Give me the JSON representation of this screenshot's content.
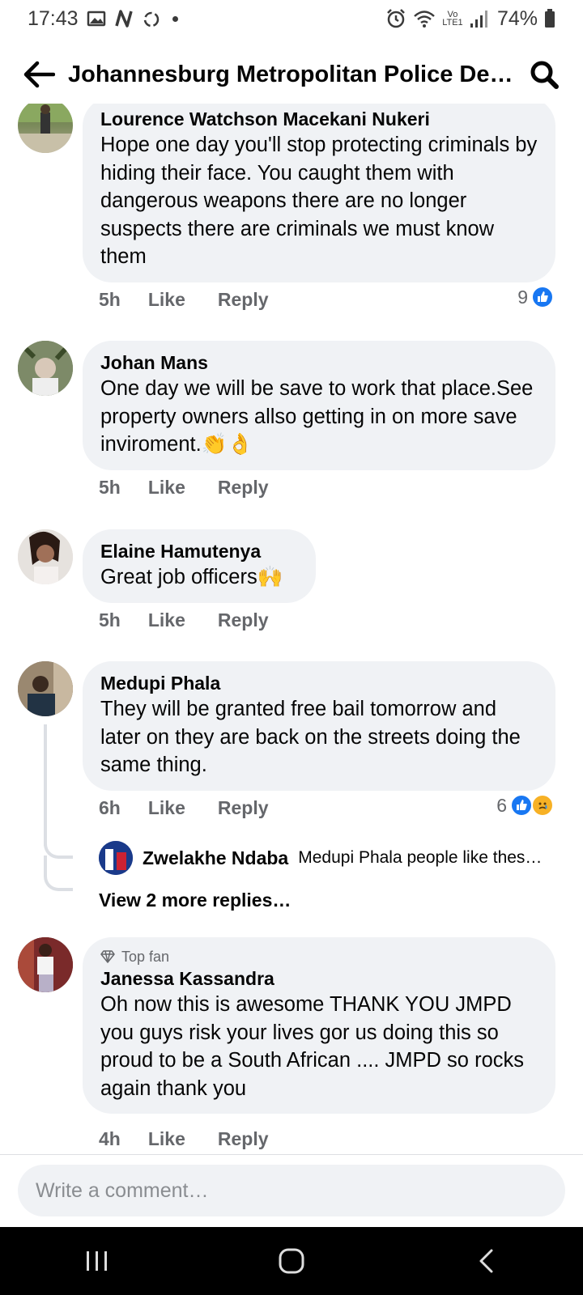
{
  "status_bar": {
    "time": "17:43",
    "battery": "74%",
    "network": "Vo LTE1"
  },
  "header": {
    "title": "Johannesburg Metropolitan Police Dep…"
  },
  "comments": [
    {
      "author": "Lourence Watchson Macekani Nukeri",
      "text": "Hope one day you'll stop protecting criminals by hiding their face. You caught them with dangerous weapons there are no longer suspects there  are criminals we must know them",
      "time": "5h",
      "like_label": "Like",
      "reply_label": "Reply",
      "reaction_count": "9"
    },
    {
      "author": "Johan Mans",
      "text": "One day we will be save to work that place.See property owners allso getting in on more save inviroment.👏👌",
      "time": "5h",
      "like_label": "Like",
      "reply_label": "Reply"
    },
    {
      "author": "Elaine Hamutenya",
      "text": "Great job officers🙌",
      "time": "5h",
      "like_label": "Like",
      "reply_label": "Reply"
    },
    {
      "author": "Medupi Phala",
      "text": "They will be granted free bail tomorrow and later on they are back on the streets doing the same thing.",
      "time": "6h",
      "like_label": "Like",
      "reply_label": "Reply",
      "reaction_count": "6",
      "reply_preview": {
        "author": "Zwelakhe Ndaba",
        "text": "Medupi Phala people like thes…"
      },
      "more_replies": "View 2 more replies…"
    },
    {
      "badge": "Top fan",
      "author": "Janessa Kassandra",
      "text": "Oh now this is awesome THANK YOU JMPD you guys risk your lives gor us doing this so proud to be a South African .... JMPD so rocks again thank you",
      "time": "4h",
      "like_label": "Like",
      "reply_label": "Reply"
    }
  ],
  "composer": {
    "placeholder": "Write a comment…"
  },
  "colors": {
    "bubble": "#f0f2f5",
    "like_blue": "#1877f2",
    "meta_gray": "#65676b"
  }
}
